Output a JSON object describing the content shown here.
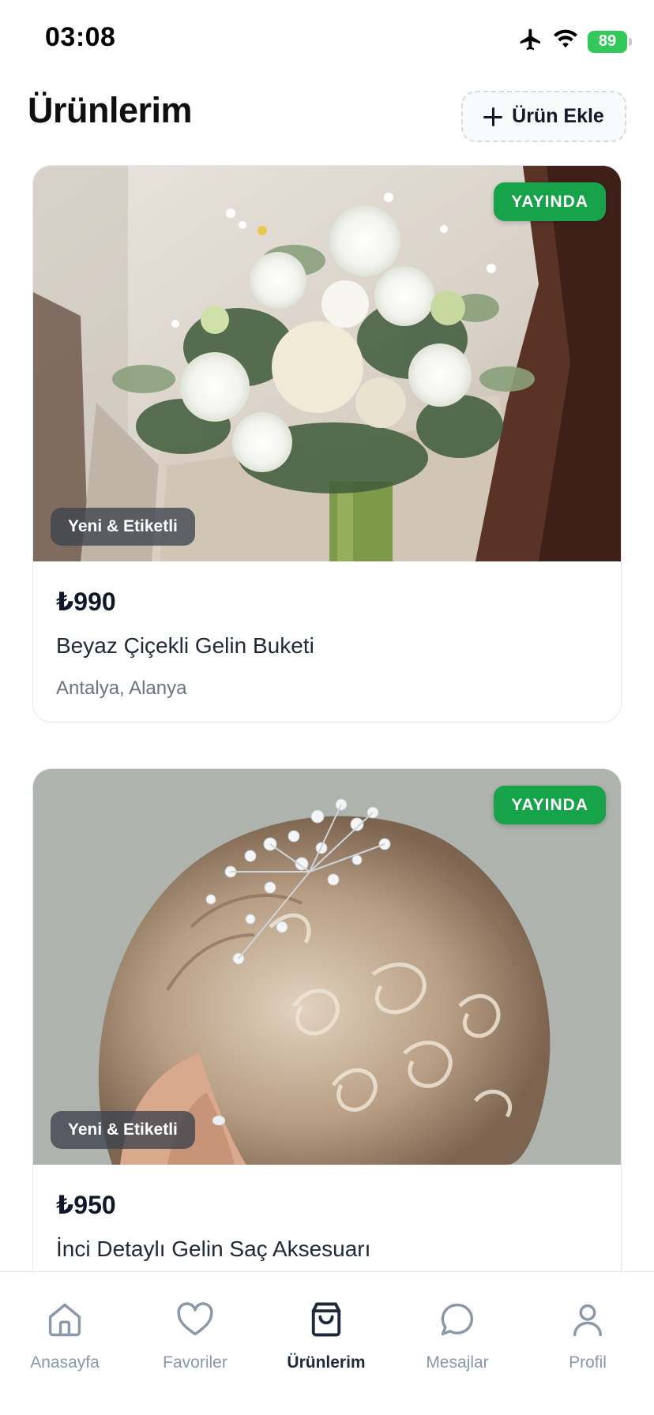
{
  "status_bar": {
    "time": "03:08",
    "battery": "89"
  },
  "header": {
    "title": "Ürünlerim",
    "add_button_label": "Ürün Ekle"
  },
  "products": [
    {
      "price": "₺990",
      "title": "Beyaz Çiçekli Gelin Buketi",
      "location": "Antalya, Alanya",
      "status": "YAYINDA",
      "condition": "Yeni & Etiketli"
    },
    {
      "price": "₺950",
      "title": "İnci Detaylı Gelin Saç Aksesuarı",
      "status": "YAYINDA",
      "condition": "Yeni & Etiketli"
    }
  ],
  "tabs": [
    {
      "label": "Anasayfa",
      "icon": "home-icon",
      "active": false
    },
    {
      "label": "Favoriler",
      "icon": "heart-icon",
      "active": false
    },
    {
      "label": "Ürünlerim",
      "icon": "shopping-bag-icon",
      "active": true
    },
    {
      "label": "Mesajlar",
      "icon": "chat-bubble-icon",
      "active": false
    },
    {
      "label": "Profil",
      "icon": "user-icon",
      "active": false
    }
  ],
  "colors": {
    "accent_green": "#16a34a",
    "tab_inactive": "#8a98aa",
    "tab_active": "#1e293b"
  }
}
